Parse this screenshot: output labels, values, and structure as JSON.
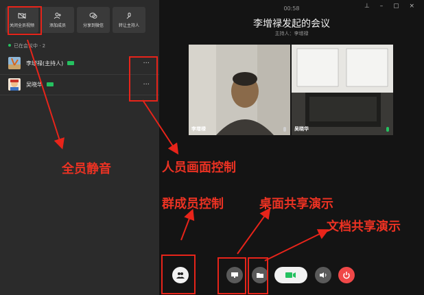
{
  "toolbar": {
    "items": [
      {
        "label": "关闭全员视频",
        "icon": "camera-off-icon"
      },
      {
        "label": "添加成员",
        "icon": "add-user-icon"
      },
      {
        "label": "分享到微信",
        "icon": "wechat-icon"
      },
      {
        "label": "转让主持人",
        "icon": "transfer-host-icon"
      }
    ]
  },
  "members": {
    "status": "已在会议中 · 2",
    "list": [
      {
        "name": "李增禄(主持人)",
        "more": "···"
      },
      {
        "name": "吴晓华",
        "more": "···"
      }
    ]
  },
  "meeting": {
    "timer": "00:58",
    "title": "李增禄发起的会议",
    "host": "主持人：李增禄",
    "window_controls": "⊥ – ▢ ×"
  },
  "videos": [
    {
      "name": "李增禄"
    },
    {
      "name": "吴晓华"
    }
  ],
  "annotations": {
    "mute_all": "全员静音",
    "person_video": "人员画面控制",
    "group_member": "群成员控制",
    "desktop_share": "桌面共享演示",
    "doc_share": "文档共享演示"
  },
  "colors": {
    "accent_green": "#25c160",
    "annotation_red": "#e8241a",
    "hangup_red": "#f04848"
  }
}
